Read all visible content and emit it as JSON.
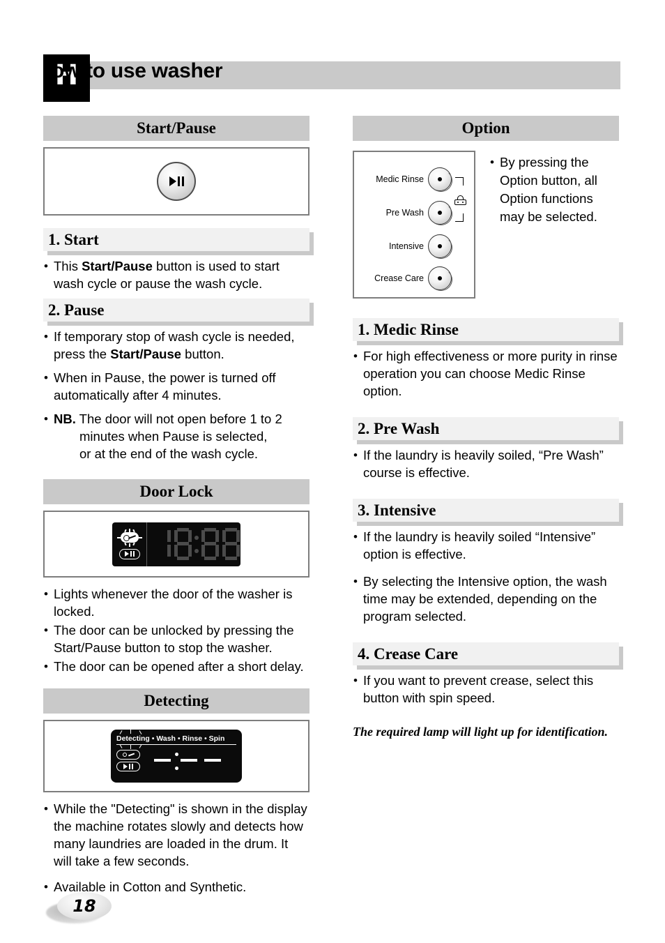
{
  "header": {
    "badge_letter": "H",
    "title": "ow to use washer"
  },
  "left_column": {
    "startpause": {
      "bar_title": "Start/Pause",
      "button_icon": "play-pause-icon",
      "subsections": [
        {
          "title": "1. Start",
          "bullets": [
            {
              "parts": [
                {
                  "t": "This ",
                  "b": false
                },
                {
                  "t": "Start/Pause",
                  "b": true
                },
                {
                  "t": " button is used  to start wash cycle or pause the wash cycle.",
                  "b": false
                }
              ]
            }
          ]
        },
        {
          "title": "2. Pause",
          "bullets": [
            {
              "parts": [
                {
                  "t": "If temporary stop of wash cycle is needed, press the ",
                  "b": false
                },
                {
                  "t": "Start/Pause",
                  "b": true
                },
                {
                  "t": " button.",
                  "b": false
                }
              ]
            },
            {
              "parts": [
                {
                  "t": "When in Pause, the power is turned off automatically after 4 minutes.",
                  "b": false
                }
              ]
            },
            {
              "parts": [
                {
                  "t": "NB.",
                  "b": true
                },
                {
                  "t": " The door will not open before 1 to 2",
                  "b": false
                }
              ],
              "indented": "minutes when Pause is selected,\nor at the end of the wash cycle."
            }
          ]
        }
      ]
    },
    "door_lock": {
      "bar_title": "Door Lock",
      "display": {
        "lock_icon": "key-lock-icon",
        "play_pause_icon": "play-pause-icon",
        "digits": "18:88"
      },
      "bullets": [
        "Lights whenever the door of  the washer is locked.",
        "The door can be unlocked by pressing the Start/Pause button to stop the washer.",
        "The door can be opened after a short delay."
      ]
    },
    "detecting": {
      "bar_title": "Detecting",
      "display": {
        "stages": [
          "Detecting",
          "Wash",
          "Rinse",
          "Spin"
        ],
        "separator": "•",
        "lock_icon": "key-lock-icon",
        "play_pause_icon": "play-pause-icon"
      },
      "bullets": [
        "While the \"Detecting\" is shown in the display the machine rotates slowly and detects how many laundries are loaded in the drum. It will take a few seconds.",
        "Available in Cotton and Synthetic."
      ]
    }
  },
  "right_column": {
    "option": {
      "bar_title": "Option",
      "panel": {
        "leds": [
          "Medic Rinse",
          "Pre Wash",
          "Intensive",
          "Crease Care"
        ],
        "press_icon": "hand-press-icon"
      },
      "bullets": [
        "By pressing the Option button, all Option functions may be selected."
      ]
    },
    "subsections": [
      {
        "title": "1. Medic Rinse",
        "bullets": [
          "For high effectiveness or more purity in rinse operation you can choose Medic Rinse option."
        ]
      },
      {
        "title": "2. Pre Wash",
        "bullets": [
          "If the laundry is heavily soiled, “Pre Wash” course is effective."
        ]
      },
      {
        "title": "3. Intensive",
        "bullets": [
          "If the laundry is heavily soiled “Intensive” option is effective.",
          "By selecting the Intensive option, the wash time may be extended, depending on the program selected."
        ]
      },
      {
        "title": "4. Crease Care",
        "bullets": [
          "If you want to prevent crease, select this button with spin speed."
        ]
      }
    ],
    "footer_note": "The required lamp will light up for identification."
  },
  "page_number": "18",
  "colors": {
    "bar_gray": "#c9c9c9",
    "subbar_gray": "#f1f1f1",
    "lcd_black": "#0b0b0b",
    "segment_gray": "#4b4b4b",
    "frame_gray": "#7d7d7d"
  }
}
